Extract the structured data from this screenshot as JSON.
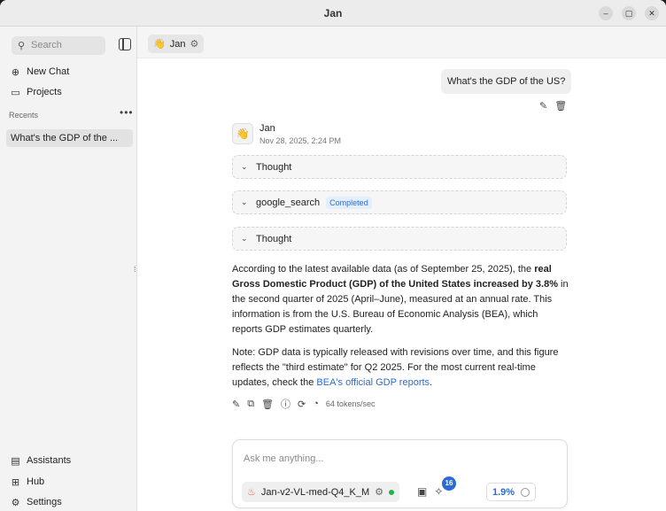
{
  "window": {
    "title": "Jan",
    "min": "–",
    "max": "▢",
    "close": "✕"
  },
  "sidebar": {
    "search_placeholder": "Search",
    "new_chat": "New Chat",
    "projects": "Projects",
    "recents_label": "Recents",
    "recents_more": "•••",
    "recents": [
      "What's the GDP of the ..."
    ],
    "bottom": [
      {
        "label": "Assistants",
        "icon": "clipboard-icon"
      },
      {
        "label": "Hub",
        "icon": "grid-icon"
      },
      {
        "label": "Settings",
        "icon": "gear-icon"
      }
    ]
  },
  "topbar": {
    "assistant_emoji": "👋",
    "assistant_name": "Jan"
  },
  "conversation": {
    "user_message": "What's the GDP of the US?",
    "assistant": {
      "avatar": "👋",
      "name": "Jan",
      "time": "Nov 28, 2025, 2:24 PM"
    },
    "steps": [
      {
        "label": "Thought"
      },
      {
        "label": "google_search",
        "badge": "Completed"
      },
      {
        "label": "Thought"
      }
    ],
    "answer": {
      "p1_a": "According to the latest available data (as of September 25, 2025), the ",
      "p1_b": "real Gross Domestic Product (GDP) of the United States increased by 3.8%",
      "p1_c": " in the second quarter of 2025 (April–June), measured at an annual rate. This information is from the U.S. Bureau of Economic Analysis (BEA), which reports GDP estimates quarterly.",
      "p2_a": "Note: GDP data is typically released with revisions over time, and this figure reflects the \"third estimate\" for Q2 2025. For the most current real-time updates, check the ",
      "p2_link": "BEA's official GDP reports",
      "p2_b": "."
    },
    "tokens": "64 tokens/sec"
  },
  "composer": {
    "placeholder": "Ask me anything...",
    "model": "Jan-v2-VL-med-Q4_K_M",
    "tools_count": "16",
    "usage": "1.9%"
  },
  "colors": {
    "accent": "#2a6bd4",
    "status_dot": "#22b34a"
  }
}
